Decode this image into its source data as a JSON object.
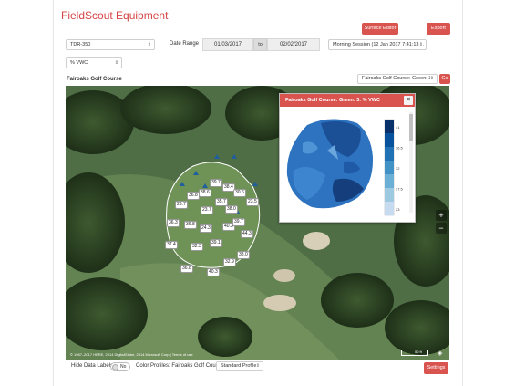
{
  "app": {
    "title": "FieldScout Equipment"
  },
  "toolbar": {
    "surface_editor_label": "Surface Editor",
    "export_label": "Export"
  },
  "filters": {
    "device_select": "TDR-350",
    "date_range_label": "Date Range",
    "start_date": "01/03/2017",
    "to_label": "to",
    "end_date": "02/02/2017",
    "session_select": "Morning Session (12 Jan 2017 7:41:13 A",
    "measure_select": "% VWC"
  },
  "map_header": {
    "course_title": "Fairoaks Golf Course",
    "green_select": "Fairoaks Golf Course: Green: 3",
    "go_label": "Go"
  },
  "map": {
    "readings": [
      "39.7",
      "38.4",
      "38.6",
      "30.6",
      "36.8",
      "23.7",
      "35.7",
      "38.0",
      "23.5",
      "23.7",
      "36.3",
      "36.8",
      "24.3",
      "40.3",
      "39.7",
      "44.3",
      "37.4",
      "32.3",
      "39.1",
      "38.0",
      "32.9",
      "36.8",
      "40.3"
    ],
    "attribution": "© 1987–2017 HERE, 2014 DigitalGlobe, 2014 Microsoft Corp | Terms of use",
    "scale_label": "50 ft",
    "zoom_in": "+",
    "zoom_out": "−"
  },
  "popup": {
    "title": "Fairoaks Golf Course: Green: 3: % VWC",
    "close_label": "×",
    "legend_ticks": [
      "41",
      "36.5",
      "32",
      "27.5",
      "23"
    ],
    "legend_colors": [
      "#08306b",
      "#08519c",
      "#2171b5",
      "#4292c6",
      "#6baed6",
      "#9ecae1",
      "#c6dbef"
    ]
  },
  "footer": {
    "hide_labels_label": "Hide Data Labels",
    "toggle_state": "No",
    "color_profiles_label": "Color Profiles: Fairoaks Golf Course",
    "profile_select": "Standard Profile",
    "settings_label": "Settings"
  }
}
